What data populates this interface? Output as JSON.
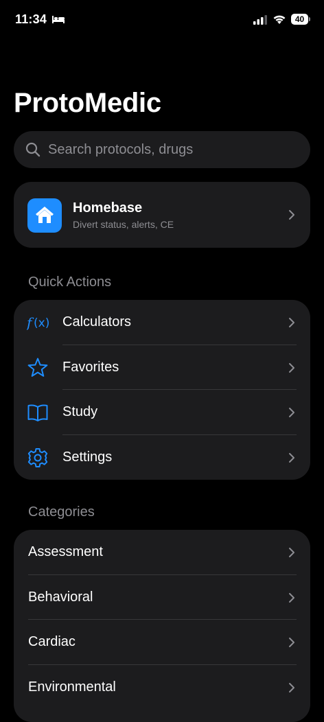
{
  "status_bar": {
    "time": "11:34",
    "battery": "40"
  },
  "app": {
    "title": "ProtoMedic"
  },
  "search": {
    "placeholder": "Search protocols, drugs"
  },
  "homebase": {
    "title": "Homebase",
    "subtitle": "Divert status, alerts, CE"
  },
  "quick_actions": {
    "heading": "Quick Actions",
    "items": [
      {
        "label": "Calculators",
        "icon": "function-icon"
      },
      {
        "label": "Favorites",
        "icon": "star-icon"
      },
      {
        "label": "Study",
        "icon": "book-icon"
      },
      {
        "label": "Settings",
        "icon": "gear-icon"
      }
    ]
  },
  "categories": {
    "heading": "Categories",
    "items": [
      {
        "label": "Assessment"
      },
      {
        "label": "Behavioral"
      },
      {
        "label": "Cardiac"
      },
      {
        "label": "Environmental"
      }
    ]
  },
  "colors": {
    "background": "#000000",
    "card": "#1c1c1e",
    "accent": "#1e8dff",
    "secondary_text": "#8e8e93",
    "divider": "#38383a"
  }
}
